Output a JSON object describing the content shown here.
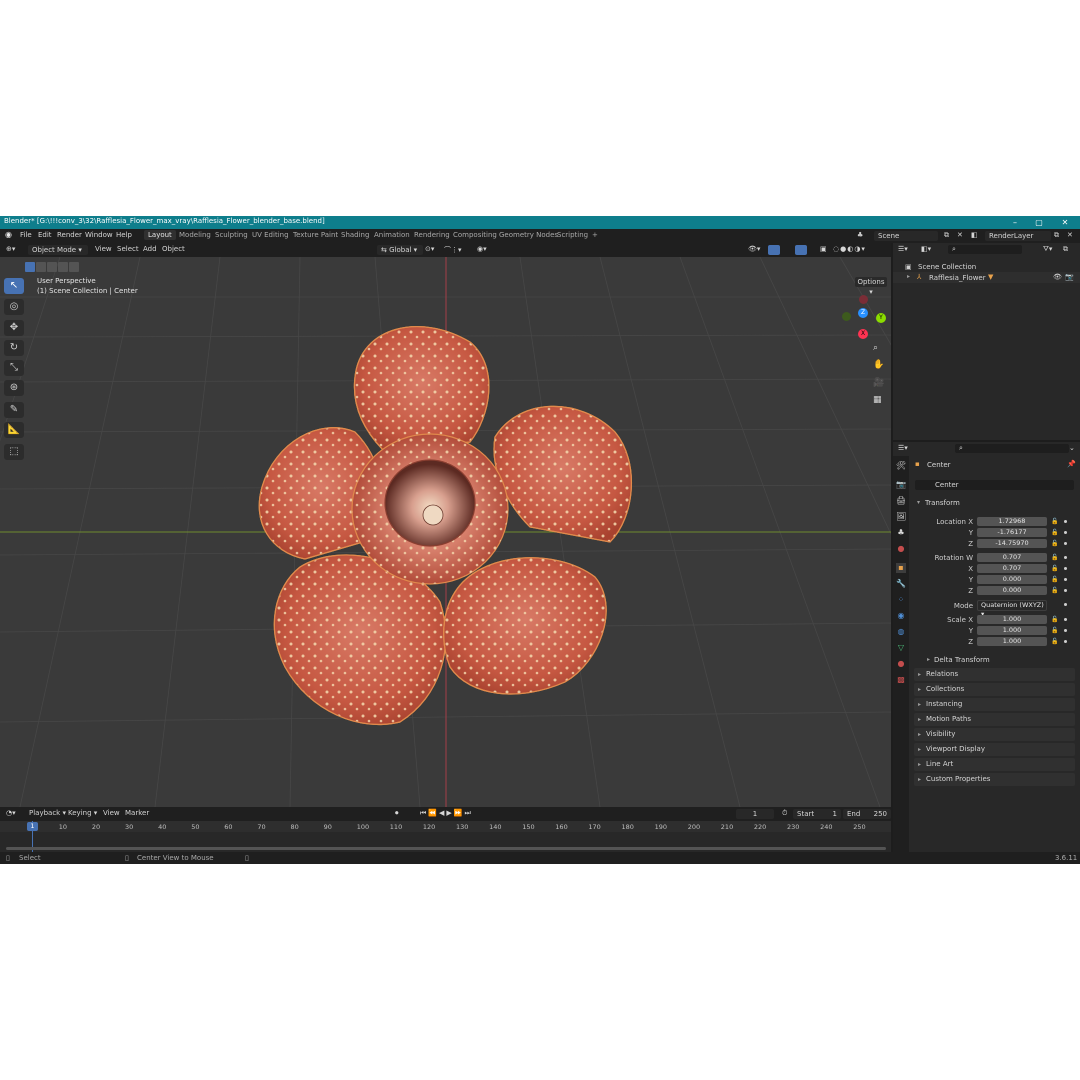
{
  "window": {
    "title": "Blender* [G:\\!!!conv_3\\32\\Rafflesia_Flower_max_vray\\Rafflesia_Flower_blender_base.blend]",
    "controls": [
      "–",
      "▢",
      "✕"
    ]
  },
  "menubar": {
    "menus": [
      "File",
      "Edit",
      "Render",
      "Window",
      "Help"
    ],
    "workspaces": [
      "Layout",
      "Modeling",
      "Sculpting",
      "UV Editing",
      "Texture Paint",
      "Shading",
      "Animation",
      "Rendering",
      "Compositing",
      "Geometry Nodes",
      "Scripting"
    ],
    "active_workspace": "Layout",
    "add_workspace": "+",
    "scene": "Scene",
    "view_layer": "RenderLayer"
  },
  "viewport_header": {
    "mode": "Object Mode",
    "menus": [
      "View",
      "Select",
      "Add",
      "Object"
    ],
    "orientation": "Global",
    "options": "Options"
  },
  "viewport": {
    "perspective": "User Perspective",
    "collection_info": "(1) Scene Collection | Center",
    "gizmo_axes": [
      "X",
      "Y",
      "Z"
    ]
  },
  "outliner": {
    "root": "Scene Collection",
    "items": [
      {
        "name": "Rafflesia_Flower"
      }
    ]
  },
  "properties": {
    "object_name": "Center",
    "data_name": "Center",
    "transform_title": "Transform",
    "location": {
      "label": "Location X",
      "x": "1.72968",
      "y": "-1.76177",
      "z": "-14.75970"
    },
    "rotation": {
      "label": "Rotation W",
      "w": "0.707",
      "x": "0.707",
      "y": "0.000",
      "z": "0.000"
    },
    "axis_labels": {
      "x": "X",
      "y": "Y",
      "z": "Z"
    },
    "mode_label": "Mode",
    "mode_value": "Quaternion (WXYZ)",
    "scale": {
      "label": "Scale X",
      "x": "1.000",
      "y": "1.000",
      "z": "1.000"
    },
    "delta_transform": "Delta Transform",
    "panels": [
      "Relations",
      "Collections",
      "Instancing",
      "Motion Paths",
      "Visibility",
      "Viewport Display",
      "Line Art",
      "Custom Properties"
    ]
  },
  "timeline": {
    "menus": [
      "Playback",
      "Keying",
      "View",
      "Marker"
    ],
    "current_frame": "1",
    "start_label": "Start",
    "start": "1",
    "end_label": "End",
    "end": "250",
    "ticks": [
      "1",
      "10",
      "20",
      "30",
      "40",
      "50",
      "60",
      "70",
      "80",
      "90",
      "100",
      "110",
      "120",
      "130",
      "140",
      "150",
      "160",
      "170",
      "180",
      "190",
      "200",
      "210",
      "220",
      "230",
      "240",
      "250"
    ]
  },
  "statusbar": {
    "left": "Select",
    "middle": "Center View to Mouse",
    "version": "3.6.11"
  },
  "colors": {
    "accent": "#4772b3",
    "titlebar": "#0e7e8c",
    "petal": "#c95b45",
    "x_axis": "#ff3352",
    "y_axis": "#8bdc00",
    "z_axis": "#2890ff"
  }
}
